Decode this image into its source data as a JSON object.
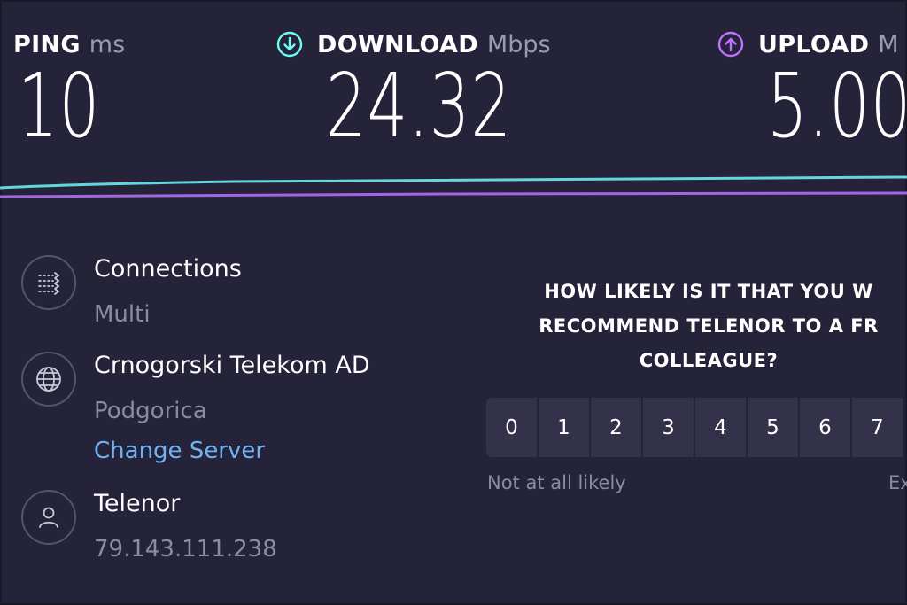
{
  "metrics": {
    "ping": {
      "label": "PING",
      "unit": "ms",
      "value": "10"
    },
    "download": {
      "label": "DOWNLOAD",
      "unit": "Mbps",
      "value": "24.32",
      "icon": "download-arrow-icon",
      "color": "#6afff3"
    },
    "upload": {
      "label": "UPLOAD",
      "unit": "M",
      "value": "5.00",
      "icon": "upload-arrow-icon",
      "color": "#bf71ff"
    }
  },
  "graph": {
    "download_color": "#62d8d8",
    "upload_color": "#a566e6"
  },
  "info": {
    "connections": {
      "title": "Connections",
      "sub": "Multi",
      "icon": "connections-icon"
    },
    "server": {
      "title": "Crnogorski Telekom AD",
      "sub": "Podgorica",
      "link": "Change Server",
      "icon": "globe-icon"
    },
    "provider": {
      "title": "Telenor",
      "sub": "79.143.111.238",
      "icon": "user-icon"
    }
  },
  "survey": {
    "question_lines": [
      "HOW LIKELY IS IT THAT YOU W",
      "RECOMMEND TELENOR TO A FR",
      "COLLEAGUE?"
    ],
    "options": [
      "0",
      "1",
      "2",
      "3",
      "4",
      "5",
      "6",
      "7"
    ],
    "low_label": "Not at all likely",
    "high_label": "Ex"
  }
}
